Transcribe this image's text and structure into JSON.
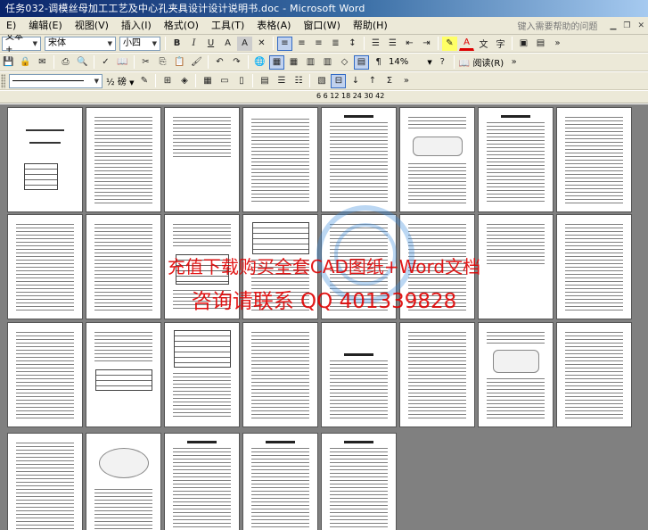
{
  "window": {
    "title": "任务032-调模丝母加工工艺及中心孔夹具设计设计说明书.doc - Microsoft Word"
  },
  "menu": {
    "items": [
      "E)",
      "编辑(E)",
      "视图(V)",
      "插入(I)",
      "格式(O)",
      "工具(T)",
      "表格(A)",
      "窗口(W)",
      "帮助(H)"
    ],
    "help_placeholder": "键入需要帮助的问题"
  },
  "toolbar1": {
    "style_value": "文本 +",
    "font_value": "宋体",
    "size_value": "小四",
    "bold": "B",
    "italic": "I",
    "underline": "U",
    "font_color_label": "A"
  },
  "toolbar2": {
    "zoom_value": "14%",
    "read_label": "阅读(R)"
  },
  "toolbar3": {
    "line_weight": "½ 磅"
  },
  "ruler": {
    "scale": "6   6  12  18  24  30     42"
  },
  "watermark": {
    "line1": "充值下载购买全套CAD图纸+Word文档",
    "line2": "咨询请联系 QQ 401339828"
  },
  "icons": {
    "window_controls": [
      "minimize-icon",
      "restore-icon",
      "close-icon"
    ]
  }
}
